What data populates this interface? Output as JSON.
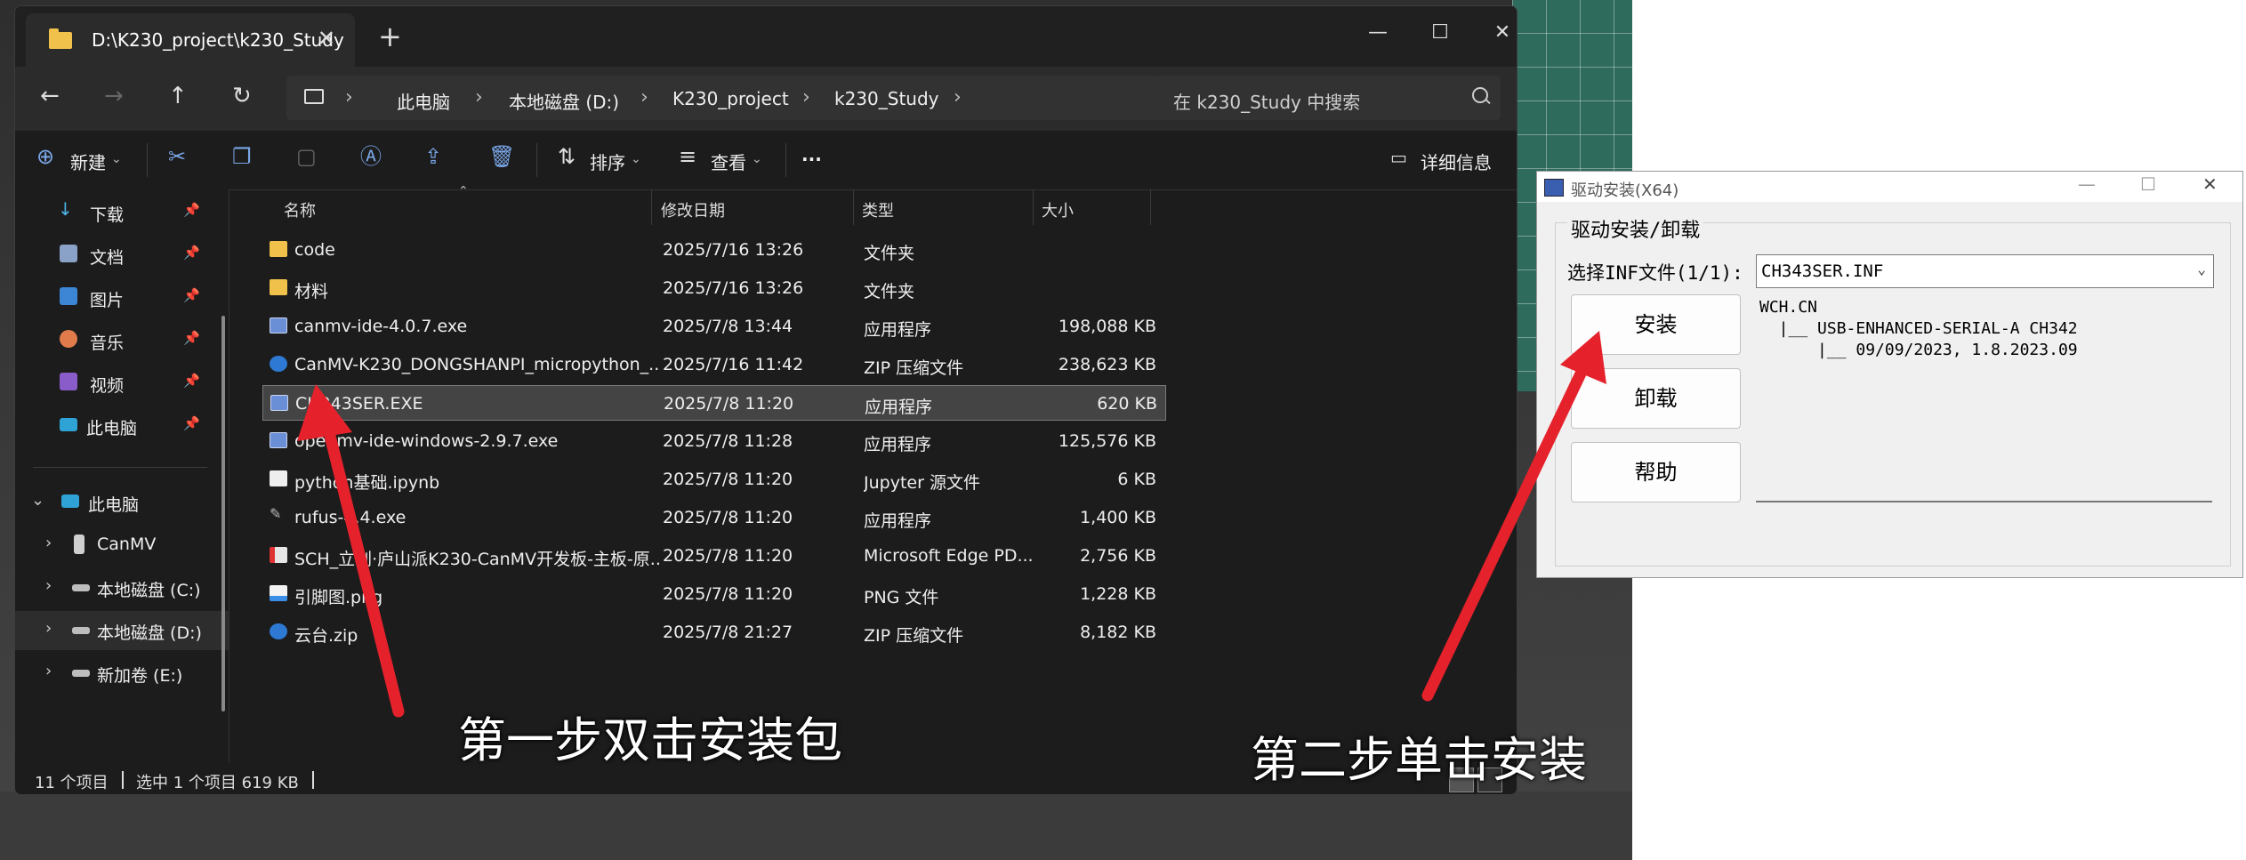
{
  "explorer": {
    "tab_title": "D:\\K230_project\\k230_Study",
    "tab_close": "✕",
    "tab_new": "+",
    "window_controls": {
      "minimize": "—",
      "maximize": "☐",
      "close": "✕"
    },
    "nav": {
      "back": "←",
      "forward": "→",
      "up": "↑",
      "refresh": "↻"
    },
    "breadcrumb": [
      "此电脑",
      "本地磁盘 (D:)",
      "K230_project",
      "k230_Study"
    ],
    "search_placeholder": "在 k230_Study 中搜索",
    "toolbar": {
      "new_label": "新建",
      "sort_label": "排序",
      "view_label": "查看",
      "more_label": "···",
      "details_label": "详细信息"
    },
    "sidebar": {
      "quick_access": [
        {
          "label": "下载",
          "icon": "download-icon"
        },
        {
          "label": "文档",
          "icon": "document-icon"
        },
        {
          "label": "图片",
          "icon": "picture-icon"
        },
        {
          "label": "音乐",
          "icon": "music-icon"
        },
        {
          "label": "视频",
          "icon": "video-icon"
        },
        {
          "label": "此电脑",
          "icon": "computer-icon"
        }
      ],
      "tree": [
        {
          "label": "此电脑",
          "icon": "computer-icon",
          "expanded": true
        },
        {
          "label": "CanMV",
          "icon": "usb-drive-icon"
        },
        {
          "label": "本地磁盘 (C:)",
          "icon": "drive-icon"
        },
        {
          "label": "本地磁盘 (D:)",
          "icon": "drive-icon",
          "selected": true
        },
        {
          "label": "新加卷 (E:)",
          "icon": "drive-icon"
        }
      ]
    },
    "columns": [
      "名称",
      "修改日期",
      "类型",
      "大小"
    ],
    "files": [
      {
        "name": "code",
        "date": "2025/7/16 13:26",
        "type": "文件夹",
        "size": "",
        "icon": "folder"
      },
      {
        "name": "材料",
        "date": "2025/7/16 13:26",
        "type": "文件夹",
        "size": "",
        "icon": "folder"
      },
      {
        "name": "canmv-ide-4.0.7.exe",
        "date": "2025/7/8 13:44",
        "type": "应用程序",
        "size": "198,088 KB",
        "icon": "exe"
      },
      {
        "name": "CanMV-K230_DONGSHANPI_micropython_...",
        "date": "2025/7/16 11:42",
        "type": "ZIP 压缩文件",
        "size": "238,623 KB",
        "icon": "zip"
      },
      {
        "name": "CH343SER.EXE",
        "date": "2025/7/8 11:20",
        "type": "应用程序",
        "size": "620 KB",
        "icon": "exe",
        "selected": true
      },
      {
        "name": "openmv-ide-windows-2.9.7.exe",
        "date": "2025/7/8 11:28",
        "type": "应用程序",
        "size": "125,576 KB",
        "icon": "exe"
      },
      {
        "name": "python基础.ipynb",
        "date": "2025/7/8 11:20",
        "type": "Jupyter 源文件",
        "size": "6 KB",
        "icon": "doc"
      },
      {
        "name": "rufus-4.4.exe",
        "date": "2025/7/8 11:20",
        "type": "应用程序",
        "size": "1,400 KB",
        "icon": "tool"
      },
      {
        "name": "SCH_立创·庐山派K230-CanMV开发板-主板-原...",
        "date": "2025/7/8 11:20",
        "type": "Microsoft Edge PD...",
        "size": "2,756 KB",
        "icon": "pdf"
      },
      {
        "name": "引脚图.png",
        "date": "2025/7/8 11:20",
        "type": "PNG 文件",
        "size": "1,228 KB",
        "icon": "png"
      },
      {
        "name": "云台.zip",
        "date": "2025/7/8 21:27",
        "type": "ZIP 压缩文件",
        "size": "8,182 KB",
        "icon": "zip"
      }
    ],
    "status": {
      "count": "11 个项目",
      "selection": "选中 1 个项目  619 KB"
    }
  },
  "installer": {
    "title": "驱动安装(X64)",
    "controls": {
      "minimize": "—",
      "maximize": "☐",
      "close": "✕"
    },
    "group_label": "驱动安装/卸载",
    "select_label": "选择INF文件(1/1):",
    "select_value": "CH343SER.INF",
    "buttons": {
      "install": "安装",
      "uninstall": "卸载",
      "help": "帮助"
    },
    "info_lines": [
      "WCH.CN",
      "  |__ USB-ENHANCED-SERIAL-A CH342",
      "      |__ 09/09/2023, 1.8.2023.09"
    ]
  },
  "annotations": {
    "step1": "第一步双击安装包",
    "step2": "第二步单击安装",
    "arrow_color": "#e5222c"
  }
}
